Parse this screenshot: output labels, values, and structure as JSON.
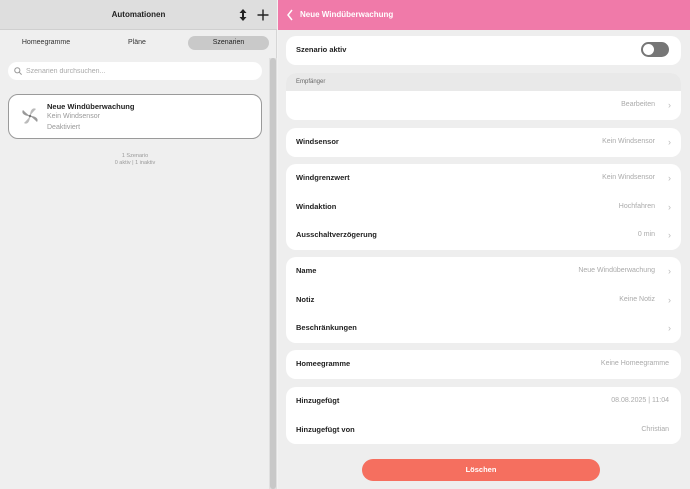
{
  "left": {
    "title": "Automationen",
    "tabs": [
      {
        "label": "Homeegramme"
      },
      {
        "label": "Pläne"
      },
      {
        "label": "Szenarien"
      }
    ],
    "search": {
      "placeholder": "Szenarien durchsuchen..."
    },
    "card": {
      "title": "Neue Windüberwachung",
      "line1": "Kein Windsensor",
      "line2": "Deaktiviert"
    },
    "summary": {
      "count": "1 Szenario",
      "status": "0 aktiv | 1 inaktiv"
    }
  },
  "right": {
    "title": "Neue Windüberwachung",
    "active": {
      "label": "Szenario aktiv",
      "on": false
    },
    "recipients": {
      "header": "Empfänger",
      "value": "Bearbeiten"
    },
    "windsensor": {
      "label": "Windsensor",
      "value": "Kein Windsensor"
    },
    "wind": {
      "limit": {
        "label": "Windgrenzwert",
        "value": "Kein Windsensor"
      },
      "action": {
        "label": "Windaktion",
        "value": "Hochfahren"
      },
      "delay": {
        "label": "Ausschaltverzögerung",
        "value": "0 min"
      }
    },
    "meta": {
      "name": {
        "label": "Name",
        "value": "Neue Windüberwachung"
      },
      "note": {
        "label": "Notiz",
        "value": "Keine Notiz"
      },
      "limits": {
        "label": "Beschränkungen"
      }
    },
    "homeegramme": {
      "label": "Homeegramme",
      "value": "Keine Homeegramme"
    },
    "added": {
      "at": {
        "label": "Hinzugefügt",
        "value": "08.08.2025 | 11:04"
      },
      "by": {
        "label": "Hinzugefügt von",
        "value": "Christian"
      }
    },
    "delete_label": "Löschen"
  }
}
